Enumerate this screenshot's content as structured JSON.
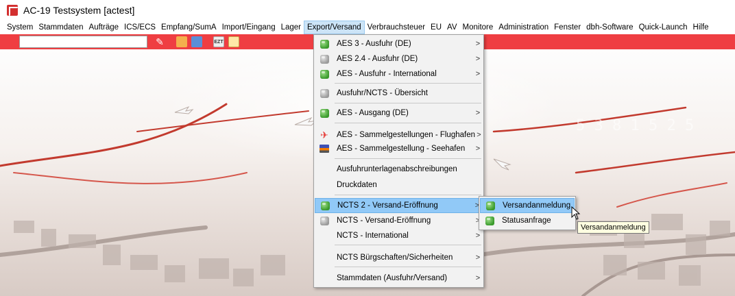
{
  "window": {
    "title": "AC-19 Testsystem  [actest]"
  },
  "menubar": {
    "items": [
      "System",
      "Stammdaten",
      "Aufträge",
      "ICS/ECS",
      "Empfang/SumA",
      "Import/Eingang",
      "Lager",
      "Export/Versand",
      "Verbrauchsteuer",
      "EU",
      "AV",
      "Monitore",
      "Administration",
      "Fenster",
      "dbh-Software",
      "Quick-Launch",
      "Hilfe"
    ],
    "active": "Export/Versand"
  },
  "toolbar": {
    "search_value": "",
    "icons": [
      "wand-icon",
      "users-icon",
      "gear-icon",
      "ezt-icon",
      "home-icon"
    ]
  },
  "export_menu": {
    "items": [
      {
        "label": "AES 3 - Ausfuhr (DE)",
        "icon": "green-cube",
        "submenu": true
      },
      {
        "label": "AES 2.4 - Ausfuhr (DE)",
        "icon": "gray-cube",
        "submenu": true
      },
      {
        "label": "AES - Ausfuhr - International",
        "icon": "green-cube",
        "submenu": true
      },
      {
        "label": "Ausfuhr/NCTS - Übersicht",
        "icon": "gray-cube",
        "submenu": false
      },
      {
        "label": "AES - Ausgang (DE)",
        "icon": "green-cube",
        "submenu": true
      },
      {
        "label": "AES - Sammelgestellungen - Flughafen",
        "icon": "plane",
        "submenu": true
      },
      {
        "label": "AES - Sammelgestellung - Seehafen",
        "icon": "ship",
        "submenu": true
      },
      {
        "label": "Ausfuhrunterlagenabschreibungen",
        "icon": "none",
        "submenu": false
      },
      {
        "label": "Druckdaten",
        "icon": "none",
        "submenu": false
      },
      {
        "label": "NCTS 2 - Versand-Eröffnung",
        "icon": "green-cube",
        "submenu": true
      },
      {
        "label": "NCTS - Versand-Eröffnung",
        "icon": "gray-cube",
        "submenu": true
      },
      {
        "label": "NCTS - International",
        "icon": "none",
        "submenu": true
      },
      {
        "label": "NCTS Bürgschaften/Sicherheiten",
        "icon": "none",
        "submenu": true
      },
      {
        "label": "Stammdaten (Ausfuhr/Versand)",
        "icon": "none",
        "submenu": true
      }
    ],
    "highlighted": "NCTS 2 - Versand-Eröffnung",
    "arrow": ">"
  },
  "ncts_submenu": {
    "items": [
      {
        "label": "Versandanmeldung",
        "icon": "green-cube"
      },
      {
        "label": "Statusanfrage",
        "icon": "green-cube"
      }
    ],
    "highlighted": "Versandanmeldung"
  },
  "tooltip": {
    "text": "Versandanmeldung"
  },
  "colors": {
    "toolbar": "#ef3e42",
    "highlight": "#91c9f7",
    "menu_bg": "#f2f2f2"
  }
}
